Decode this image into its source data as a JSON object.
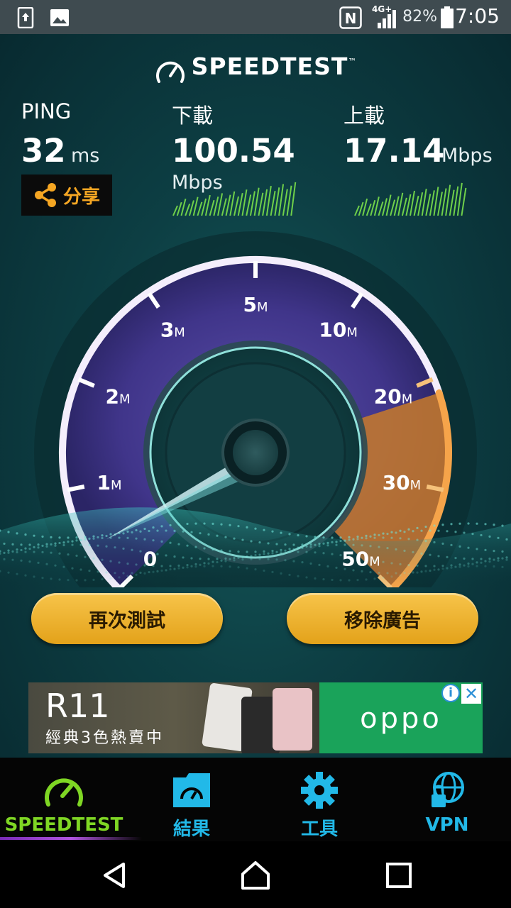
{
  "status_bar": {
    "time": "7:05",
    "battery": "82%",
    "network": "4G+",
    "icons": [
      "screenshot-icon",
      "image-icon",
      "nfc-icon",
      "signal-icon",
      "battery-icon"
    ]
  },
  "brand": {
    "name": "SPEEDTEST",
    "trademark": "™"
  },
  "stats": {
    "ping": {
      "label": "PING",
      "value": "32",
      "unit": "ms"
    },
    "download": {
      "label": "下載",
      "value": "100.54",
      "unit": "Mbps"
    },
    "upload": {
      "label": "上載",
      "value": "17.14",
      "unit": "Mbps"
    }
  },
  "share": {
    "label": "分享"
  },
  "gauge": {
    "ticks": [
      {
        "num": "0",
        "unit": ""
      },
      {
        "num": "1",
        "unit": "M"
      },
      {
        "num": "2",
        "unit": "M"
      },
      {
        "num": "3",
        "unit": "M"
      },
      {
        "num": "5",
        "unit": "M"
      },
      {
        "num": "10",
        "unit": "M"
      },
      {
        "num": "20",
        "unit": "M"
      },
      {
        "num": "30",
        "unit": "M"
      },
      {
        "num": "50",
        "unit": "M"
      }
    ]
  },
  "buttons": {
    "retest": "再次測試",
    "remove_ads": "移除廣告"
  },
  "ad": {
    "title": "R11",
    "subtitle": "經典3色熱賣中",
    "brand": "oppo",
    "info": "i",
    "close": "✕"
  },
  "tabs": [
    {
      "label": "SPEEDTEST",
      "icon": "speedometer-icon",
      "active": true
    },
    {
      "label": "結果",
      "icon": "results-folder-icon",
      "active": false
    },
    {
      "label": "工具",
      "icon": "gear-icon",
      "active": false
    },
    {
      "label": "VPN",
      "icon": "vpn-globe-lock-icon",
      "active": false
    }
  ],
  "colors": {
    "accent_green": "#7fd624",
    "tab_blue": "#22b9e8",
    "gold": "#f0b232",
    "share_orange": "#f5a623"
  }
}
